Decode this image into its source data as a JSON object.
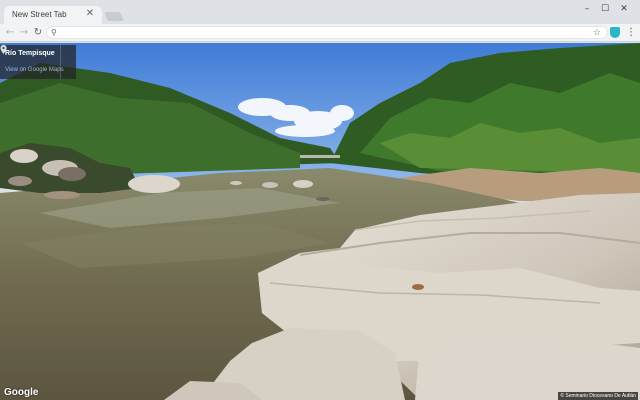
{
  "browser": {
    "tab": {
      "title": "New Street Tab",
      "close_glyph": "✕"
    },
    "window_controls": {
      "minimize": "–",
      "maximize": "☐",
      "close": "✕"
    },
    "nav": {
      "back": "←",
      "forward": "→",
      "reload": "↻"
    },
    "omnibox": {
      "value": "",
      "search_glyph": "⚲",
      "star_glyph": "☆"
    },
    "menu_glyph": "⋮",
    "extension_color": "#29b6c8"
  },
  "streetview": {
    "place_name": "Río Tempisque",
    "view_link": "View on Google Maps",
    "logo": "Google",
    "attribution": "© Seminario Diocesano De Autlán"
  },
  "icons": {
    "tab_close": "close-icon",
    "search": "search-icon",
    "bookmark": "star-icon",
    "extension": "shield-icon",
    "menu": "kebab-menu-icon",
    "pin": "map-pin-icon"
  }
}
